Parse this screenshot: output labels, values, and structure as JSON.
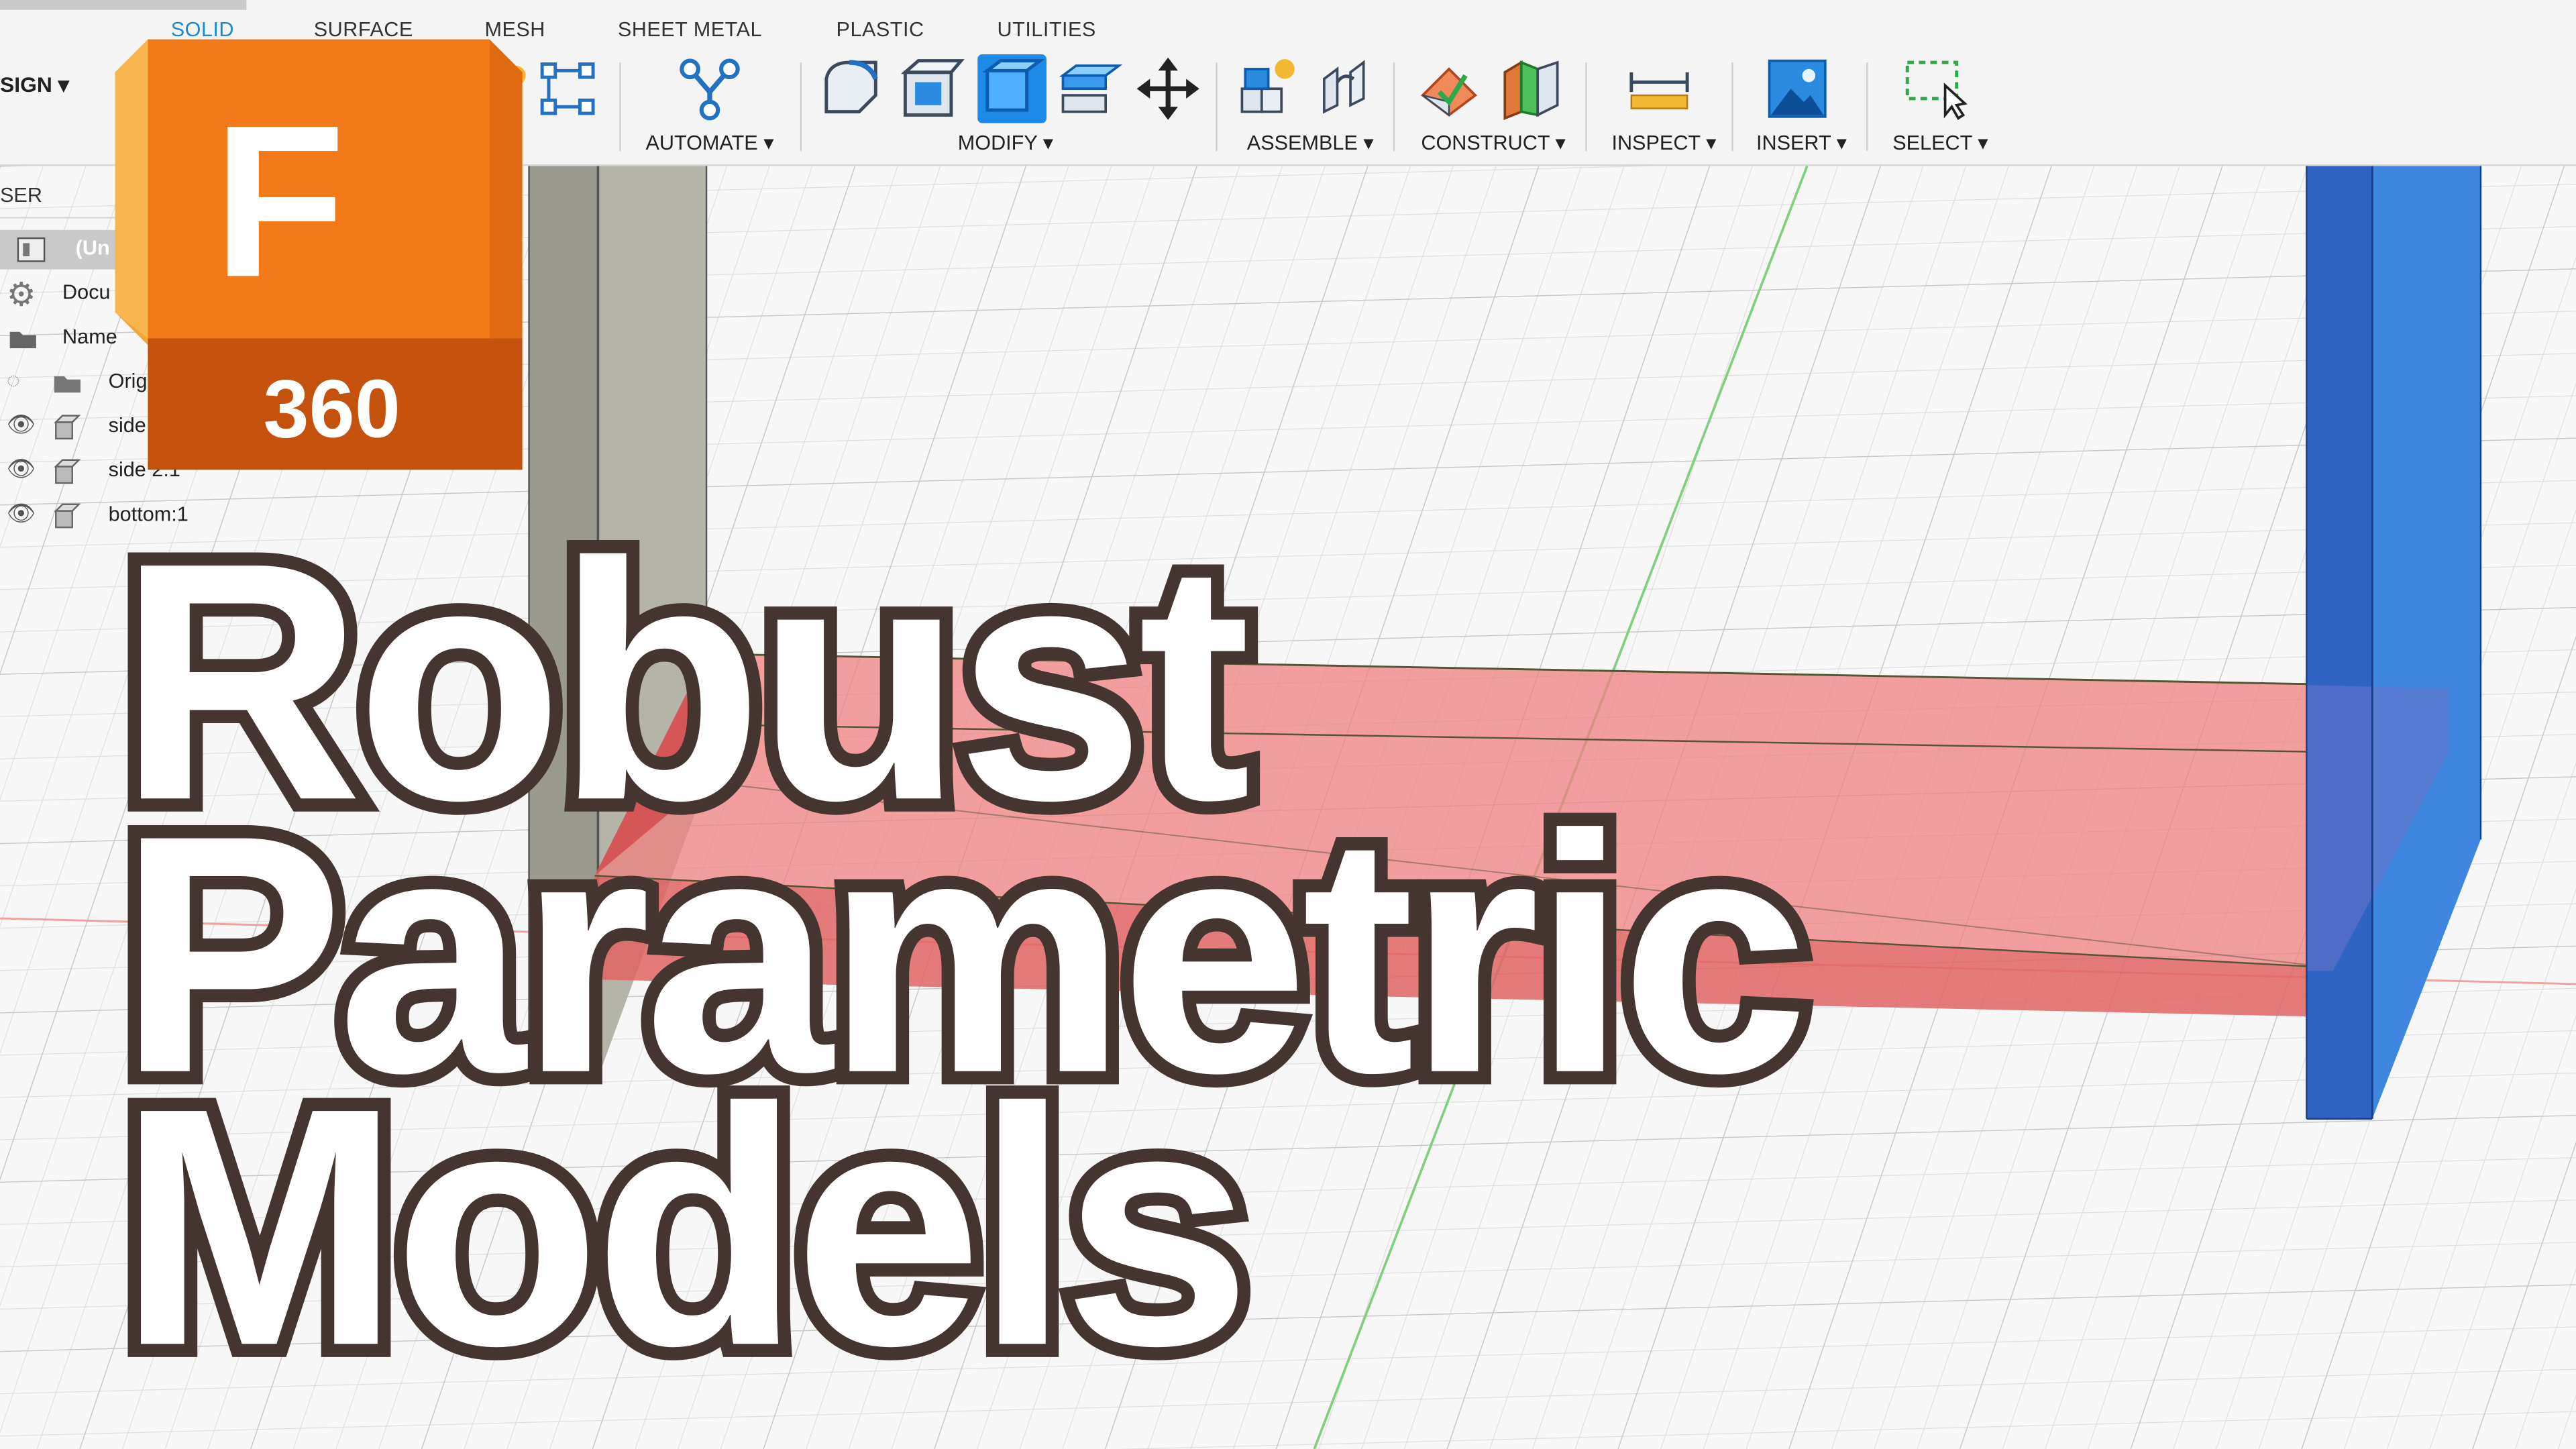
{
  "app": {
    "tabs": [
      "SOLID",
      "SURFACE",
      "MESH",
      "SHEET METAL",
      "PLASTIC",
      "UTILITIES"
    ],
    "active_tab": "SOLID",
    "workspace_label": "SIGN"
  },
  "toolbar": {
    "groups": [
      "AUTOMATE",
      "MODIFY",
      "ASSEMBLE",
      "CONSTRUCT",
      "INSPECT",
      "INSERT",
      "SELECT"
    ]
  },
  "browser": {
    "title": "SER",
    "items": [
      "(Un",
      "Docu",
      "Name",
      "Origi",
      "side",
      "side 2:1",
      "bottom:1"
    ]
  },
  "logo": {
    "letter": "F",
    "number": "360",
    "colors": {
      "light": "#f6a532",
      "main": "#f27a18",
      "dark": "#c4520d"
    }
  },
  "title_lines": [
    "Robust",
    "Parametric",
    "Models"
  ],
  "colors": {
    "accent_blue": "#1a8bd1",
    "title_fill": "#ffffff",
    "title_outline": "#453530",
    "red_body": "#f08080",
    "blue_body": "#2f6fd0",
    "grey_body": "#9a9a90"
  }
}
